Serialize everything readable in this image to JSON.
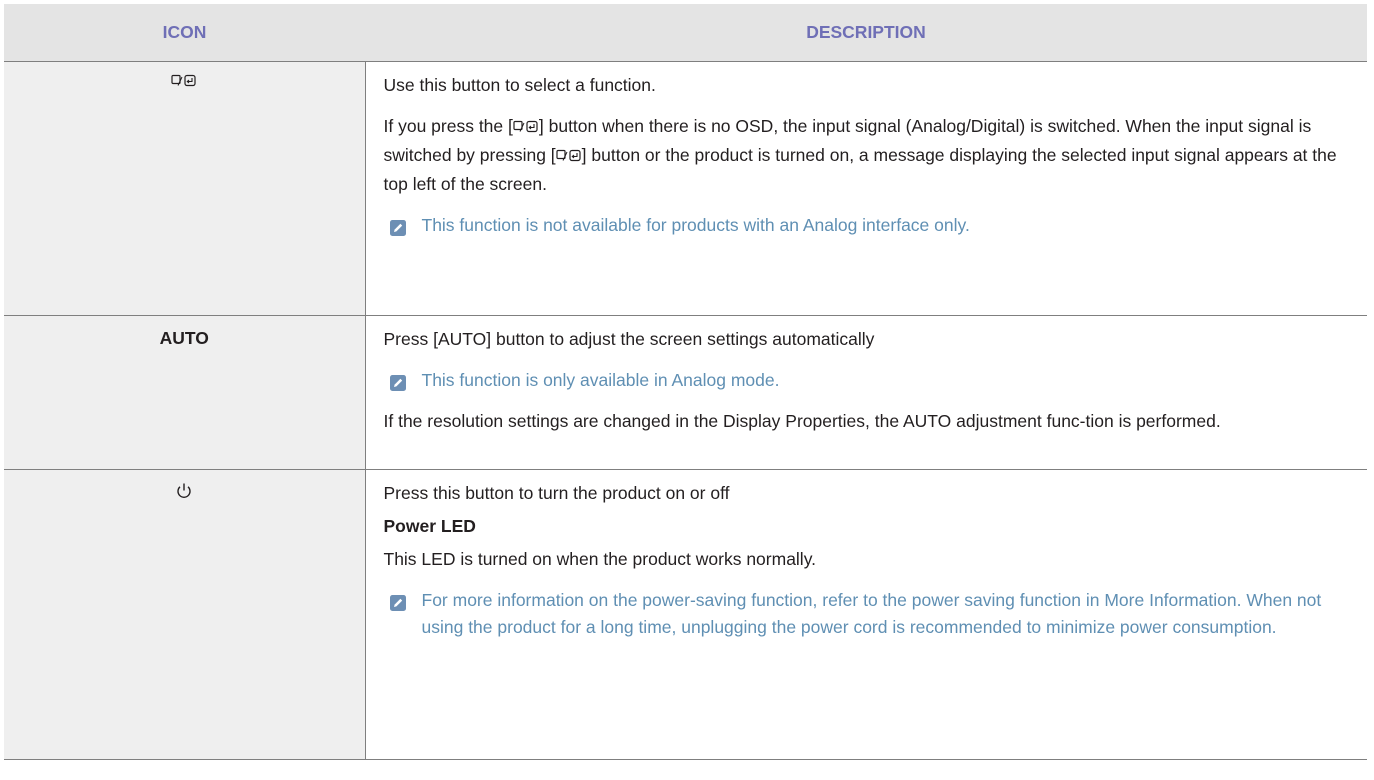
{
  "table": {
    "headers": {
      "icon": "ICON",
      "description": "DESCRIPTION"
    },
    "rows": [
      {
        "icon_name": "source-enter-icon",
        "lines": [
          "Use this button to select a function.",
          "If you press the [",
          "] button when there is no OSD, the input signal (Analog/Digital) is switched. When the input signal is switched by pressing [",
          "] button or the product is turned on, a message displaying the selected input signal appears at the top left of the screen."
        ],
        "note": "This function is not available for products with an Analog interface only."
      },
      {
        "icon_label": "AUTO",
        "lines": [
          "Press [AUTO] button to adjust the screen settings automatically",
          "If the resolution settings are changed in the Display Properties, the AUTO adjustment func-tion is performed."
        ],
        "note": "This function is only available in Analog mode."
      },
      {
        "icon_name": "power-icon",
        "lines": [
          "Press this button to turn the product on or off",
          "Power LED",
          "This LED is turned on when the product works normally."
        ],
        "note": "For more information on the power-saving function, refer to the power saving function in More Information. When not using the product for a long time, unplugging the power cord is recommended to minimize power consumption."
      }
    ]
  },
  "colors": {
    "header_bg": "#e4e4e4",
    "header_text": "#6f6fb6",
    "icon_col_bg": "#efefef",
    "note_text": "#5f8fb3",
    "body_text": "#231f20"
  }
}
